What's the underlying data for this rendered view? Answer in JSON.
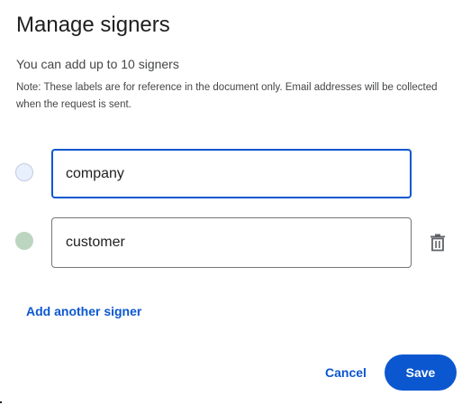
{
  "dialog": {
    "title": "Manage signers",
    "subtitle": "You can add up to 10 signers",
    "note": "Note: These labels are for reference in the document only. Email addresses will be collected when the request is sent."
  },
  "signers": [
    {
      "label": "company",
      "color": "#e8f0fe",
      "focused": true,
      "deletable": false
    },
    {
      "label": "customer",
      "color": "#bcd5c1",
      "focused": false,
      "deletable": true,
      "delete_icon": "trash-icon"
    }
  ],
  "actions": {
    "add_label": "Add another signer",
    "cancel_label": "Cancel",
    "save_label": "Save"
  },
  "colors": {
    "accent": "#0b57d0",
    "text": "#1f1f1f",
    "secondary_text": "#444746"
  }
}
